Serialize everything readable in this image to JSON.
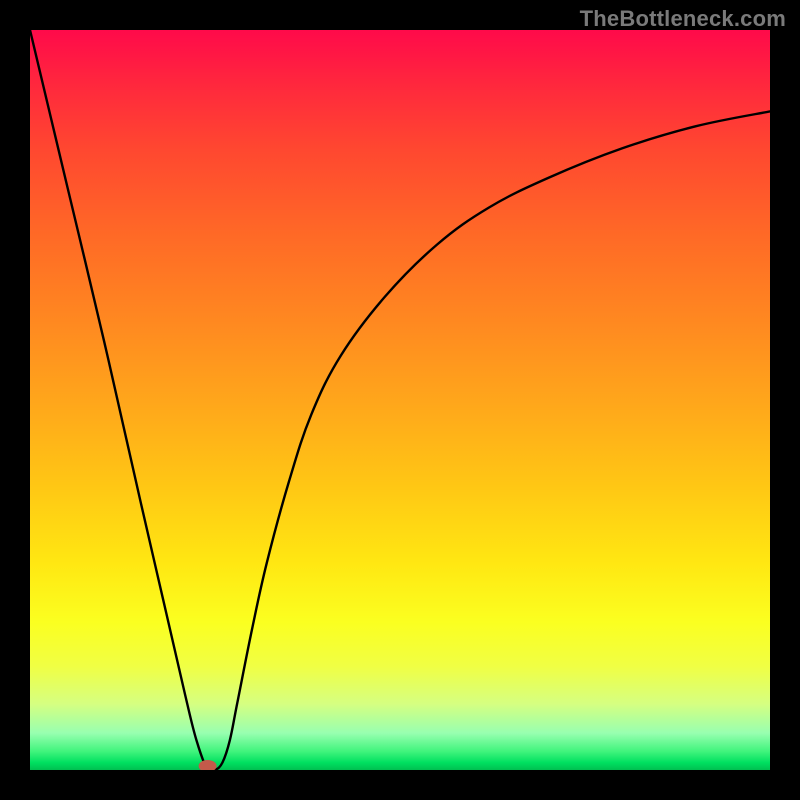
{
  "watermark": "TheBottleneck.com",
  "chart_data": {
    "type": "line",
    "title": "",
    "xlabel": "",
    "ylabel": "",
    "xlim": [
      0,
      100
    ],
    "ylim": [
      0,
      100
    ],
    "grid": false,
    "series": [
      {
        "name": "bottleneck-curve",
        "x": [
          0,
          5,
          10,
          15,
          18,
          21,
          22.5,
          24,
          25,
          26,
          27,
          28,
          30,
          32,
          35,
          38,
          42,
          48,
          55,
          62,
          70,
          80,
          90,
          100
        ],
        "values": [
          100,
          79,
          58,
          36,
          23,
          10,
          4,
          0,
          0,
          1,
          4,
          9,
          19,
          28,
          39,
          48,
          56,
          64,
          71,
          76,
          80,
          84,
          87,
          89
        ]
      }
    ],
    "annotations": [
      {
        "type": "marker",
        "name": "optimal-point",
        "x": 24,
        "y": 0,
        "color": "#c45a4a"
      }
    ],
    "background_gradient": {
      "top": "#ff0a4a",
      "bottom": "#00c050",
      "scale": [
        "red",
        "orange",
        "yellow",
        "green"
      ]
    }
  }
}
